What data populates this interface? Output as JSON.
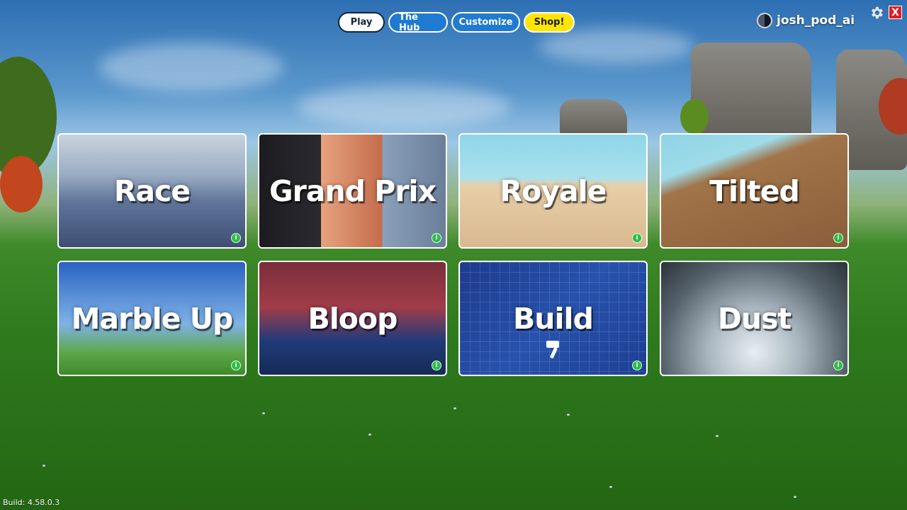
{
  "nav": {
    "tabs": [
      {
        "label": "Play",
        "active": true
      },
      {
        "label": "The Hub",
        "active": false
      },
      {
        "label": "Customize",
        "active": false
      },
      {
        "label": "Shop!",
        "active": false
      }
    ]
  },
  "user": {
    "username": "josh_pod_ai",
    "avatar_icon": "user-avatar-icon"
  },
  "window": {
    "settings_icon": "gear-icon",
    "close_label": "X"
  },
  "modes": [
    {
      "title": "Race",
      "info_icon": "info-icon"
    },
    {
      "title": "Grand Prix",
      "info_icon": "info-icon"
    },
    {
      "title": "Royale",
      "info_icon": "info-icon"
    },
    {
      "title": "Tilted",
      "info_icon": "info-icon"
    },
    {
      "title": "Marble Up",
      "info_icon": "info-icon"
    },
    {
      "title": "Bloop",
      "info_icon": "info-icon"
    },
    {
      "title": "Build",
      "info_icon": "info-icon"
    },
    {
      "title": "Dust",
      "info_icon": "info-icon"
    }
  ],
  "footer": {
    "build": "Build: 4.58.0.3"
  },
  "colors": {
    "accent_blue": "#1f7ad1",
    "shop_yellow": "#ffe600",
    "close_red": "#e11d1d",
    "info_green": "#2fbd4b"
  }
}
